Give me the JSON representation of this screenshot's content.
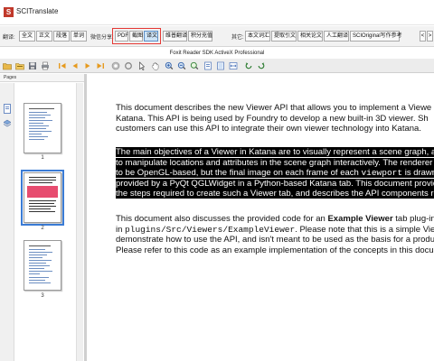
{
  "app": {
    "title": "SCITranslate",
    "icon_letter": "S"
  },
  "translate_bar": {
    "translate_label": "翻译:",
    "translate_buttons": [
      "全文",
      "正文",
      "段落",
      "单词"
    ],
    "wechat_label": "微信分享:",
    "share_buttons": [
      "PDF",
      "截图",
      "译文"
    ],
    "extra_buttons": [
      "维普翻译",
      "积分充值"
    ],
    "other_label": "其它:",
    "other_buttons": [
      "本文词汇",
      "提取引文",
      "相关论文",
      "人工翻译",
      "SCIOriginal写作参考"
    ],
    "nav_left": "<",
    "nav_right": ">"
  },
  "viewer": {
    "title": "Foxit Reader SDK ActiveX Professional"
  },
  "sidebar": {
    "header": "Pages",
    "page_numbers": [
      "1",
      "2",
      "3"
    ]
  },
  "document": {
    "p1": [
      "This document describes the new Viewer API that allows you to implement a Viewe",
      "Katana. This API is being used by Foundry to develop a new built-in 3D viewer. Sh",
      "customers can use this API to integrate their own viewer technology into Katana."
    ],
    "p2": {
      "l1": "The main objectives of a Viewer in Katana are to visually represent a scene graph, and",
      "l2": "to manipulate locations and attributes in the scene graph interactively. The renderer us",
      "l3a": "to be OpenGL-based, but the final image on each frame of each ",
      "l3code": "viewport",
      "l3b": " is drawn",
      "l4": "provided by a PyQt QGLWidget in a Python-based Katana tab. This document provide",
      "l5": "the steps required to create such a Viewer tab, and describes the API components requ"
    },
    "p3": {
      "l1a": "This document also discusses the provided code for an ",
      "l1b": "Example Viewer",
      "l1c": " tab plug-in.",
      "l2a": "in ",
      "l2code": "plugins/Src/Viewers/ExampleViewer",
      "l2b": ". Please note that this is a simple Vie",
      "l3": "demonstrate how to use the API, and isn't meant to be used as the basis for a product",
      "l4": "Please refer to this code as an example implementation of the concepts in this documer"
    }
  },
  "colors": {
    "highlight_box": "#e53935",
    "selection": "#3a7bd5",
    "share_active": "#cfe4f7"
  }
}
